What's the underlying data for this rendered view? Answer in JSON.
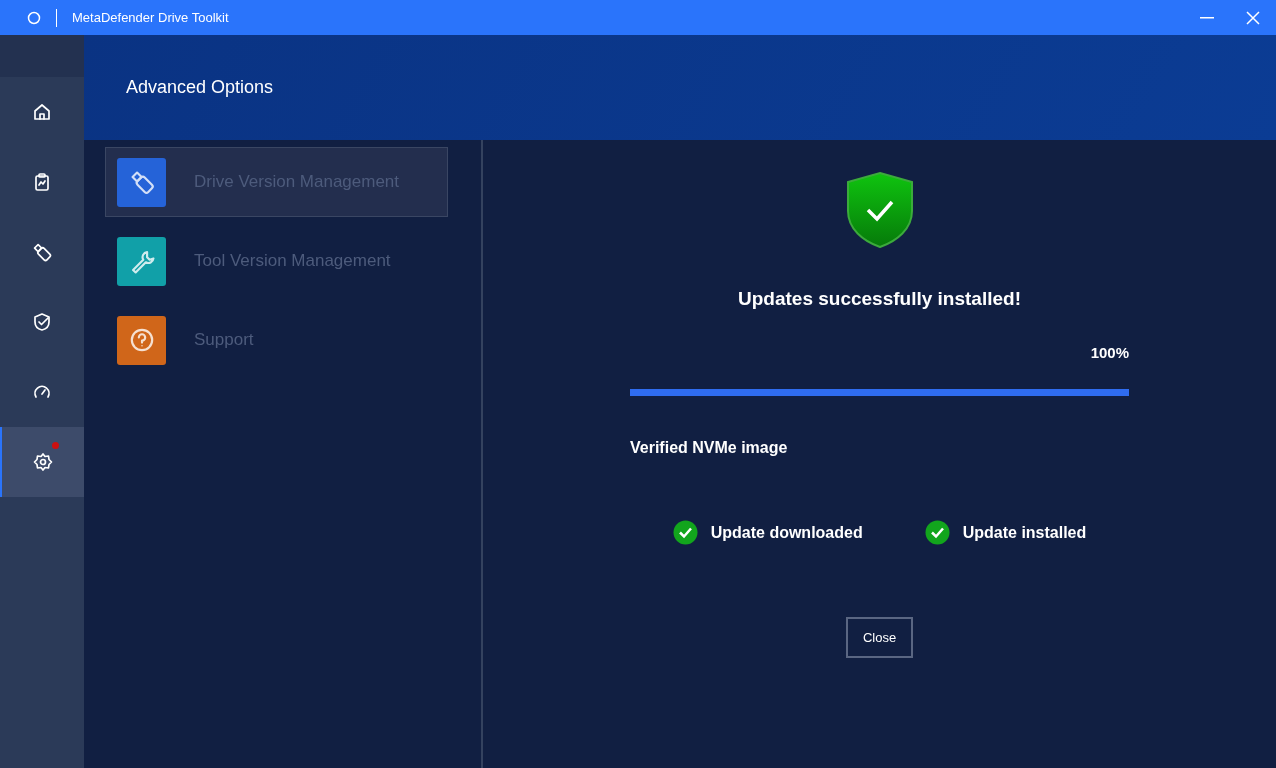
{
  "window": {
    "title": "MetaDefender Drive Toolkit"
  },
  "nav_rail": [
    {
      "kind": "home",
      "selected": false,
      "notification": false
    },
    {
      "kind": "report",
      "selected": false,
      "notification": false
    },
    {
      "kind": "drive",
      "selected": false,
      "notification": false
    },
    {
      "kind": "verify",
      "selected": false,
      "notification": false
    },
    {
      "kind": "gauge",
      "selected": false,
      "notification": false
    },
    {
      "kind": "settings",
      "selected": true,
      "notification": true
    }
  ],
  "header": {
    "title": "Advanced Options"
  },
  "menu": [
    {
      "label": "Drive Version Management",
      "kind": "drive",
      "color": "#2563d8",
      "selected": true
    },
    {
      "label": "Tool Version Management",
      "kind": "wrench",
      "color": "#11a0a8",
      "selected": false
    },
    {
      "label": "Support",
      "kind": "help",
      "color": "#d0661a",
      "selected": false
    }
  ],
  "result": {
    "title": "Updates successfully installed!",
    "percent": "100%",
    "level": 1,
    "image_label": "Verified NVMe image",
    "steps": [
      {
        "label": "Update downloaded",
        "done": true
      },
      {
        "label": "Update installed",
        "done": true
      }
    ],
    "close_button": "Close"
  }
}
